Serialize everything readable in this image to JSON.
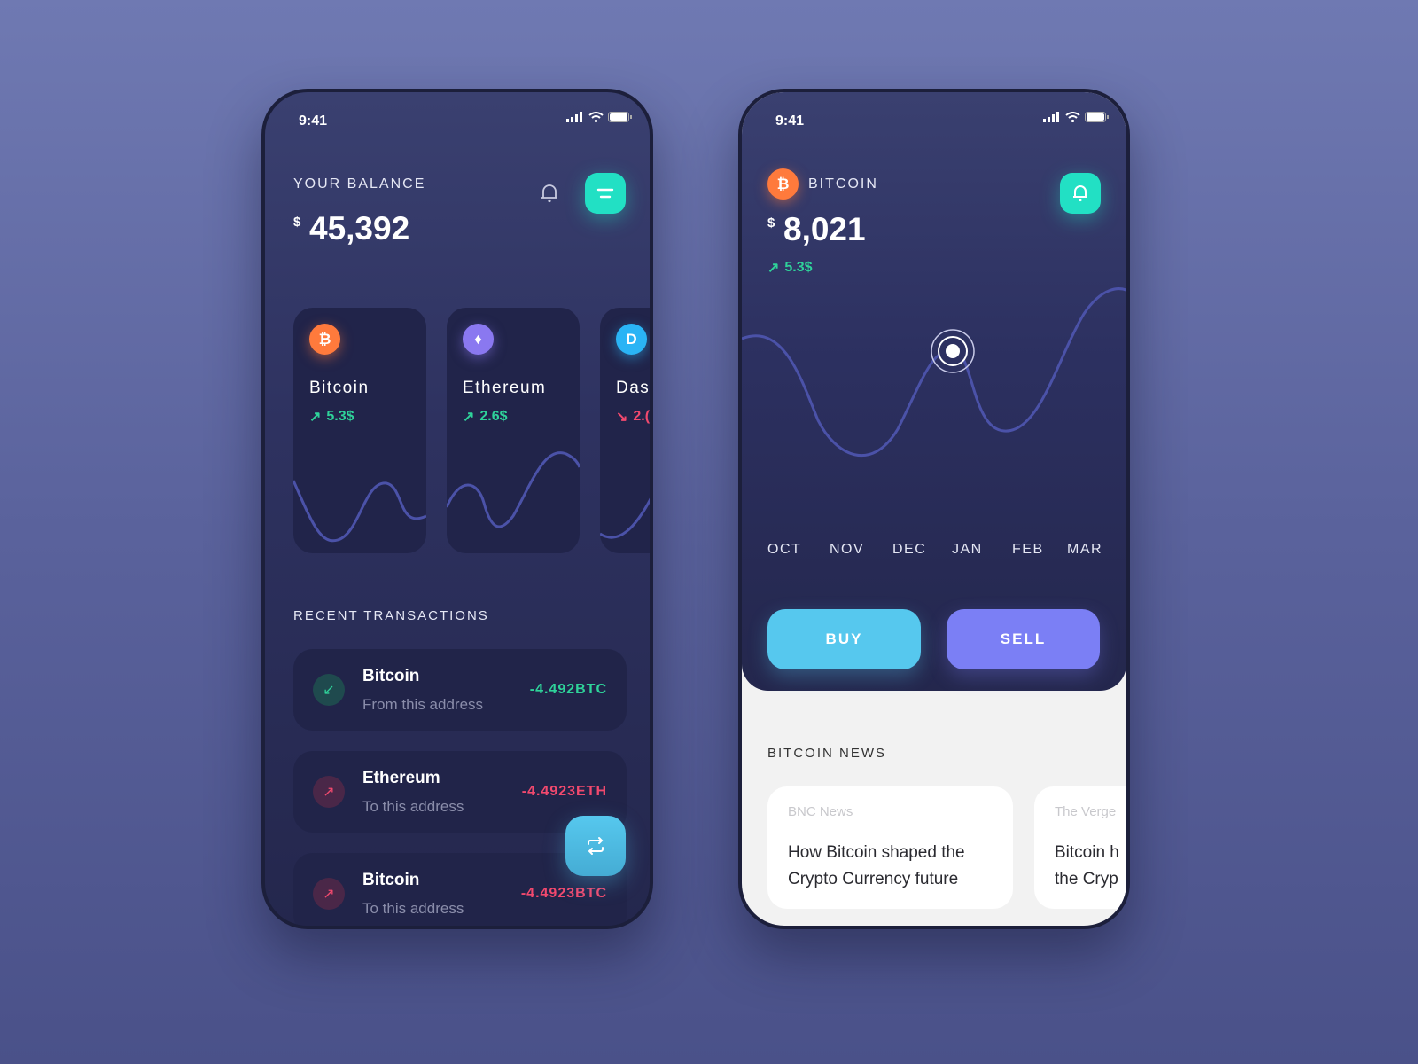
{
  "colors": {
    "accent_teal": "#22e0c4",
    "up": "#2fd39a",
    "down": "#f2496e",
    "buy": "#56c8ee",
    "sell": "#7b7ff5"
  },
  "wallet": {
    "status_time": "9:41",
    "balance_label": "YOUR BALANCE",
    "currency": "$",
    "balance": "45,392",
    "coins": [
      {
        "name": "Bitcoin",
        "change": "5.3$",
        "trend": "up",
        "icon": "bitcoin-icon"
      },
      {
        "name": "Ethereum",
        "change": "2.6$",
        "trend": "up",
        "icon": "ethereum-icon"
      },
      {
        "name": "Das",
        "change": "2.(",
        "trend": "down",
        "icon": "dash-icon"
      }
    ],
    "recent_label": "RECENT TRANSACTIONS",
    "transactions": [
      {
        "name": "Bitcoin",
        "sub": "From this address",
        "amount": "-4.492BTC",
        "direction": "in"
      },
      {
        "name": "Ethereum",
        "sub": "To this address",
        "amount": "-4.4923ETH",
        "direction": "out"
      },
      {
        "name": "Bitcoin",
        "sub": "To this address",
        "amount": "-4.4923BTC",
        "direction": "out"
      }
    ]
  },
  "detail": {
    "status_time": "9:41",
    "coin": "BITCOIN",
    "currency": "$",
    "price": "8,021",
    "change": "5.3$",
    "months": [
      "OCT",
      "NOV",
      "DEC",
      "JAN",
      "FEB",
      "MAR"
    ],
    "buy": "BUY",
    "sell": "SELL",
    "news_label": "BITCOIN NEWS",
    "news": [
      {
        "source": "BNC News",
        "title": "How Bitcoin shaped the Crypto Currency future"
      },
      {
        "source": "The Verge",
        "title": "Bitcoin h the Cryp"
      }
    ]
  }
}
